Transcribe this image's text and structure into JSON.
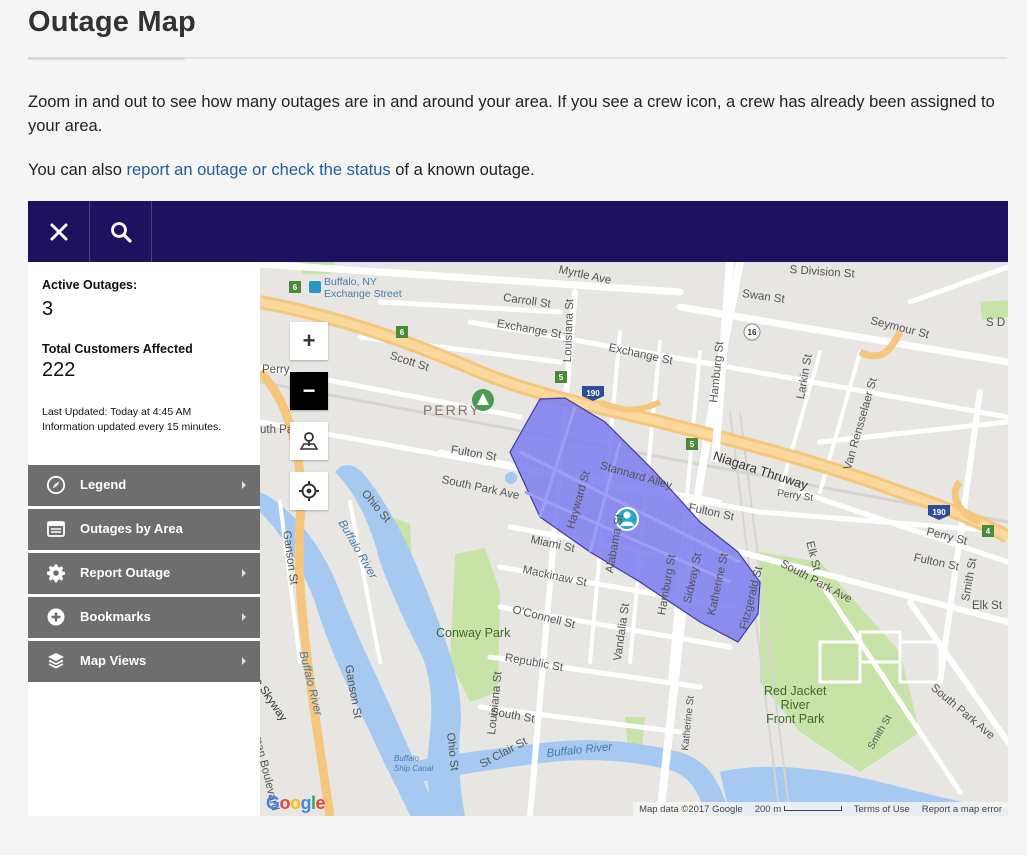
{
  "page": {
    "title": "Outage Map",
    "intro": "Zoom in and out to see how many outages are in and around your area. If you see a crew icon, a crew has already been assigned to your area.",
    "also_prefix": "You can also ",
    "also_link": "report an outage or check the status",
    "also_suffix": " of a known outage."
  },
  "toolbar": {
    "close_icon": "close-icon",
    "search_icon": "search-icon",
    "color": "#1e1160"
  },
  "stats": {
    "active_label": "Active Outages:",
    "active_value": "3",
    "customers_label": "Total Customers Affected",
    "customers_value": "222",
    "updated_line1": "Last Updated: Today at 4:45 AM",
    "updated_line2": "Information updated every 15 minutes."
  },
  "menu": [
    {
      "label": "Legend",
      "icon": "compass-icon",
      "chevron": true
    },
    {
      "label": "Outages by Area",
      "icon": "table-icon",
      "chevron": false
    },
    {
      "label": "Report Outage",
      "icon": "gear-icon",
      "chevron": true
    },
    {
      "label": "Bookmarks",
      "icon": "plus-circle-icon",
      "chevron": true
    },
    {
      "label": "Map Views",
      "icon": "layers-icon",
      "chevron": true
    }
  ],
  "map": {
    "controls": [
      "zoom-in",
      "zoom-out",
      "locate-person",
      "my-location"
    ],
    "zoom_in": "+",
    "zoom_out": "−",
    "outage_color": "#7b7bf0",
    "crew_icon": "crew-icon",
    "labels": {
      "myrtle": "Myrtle Ave",
      "s_division": "S Division St",
      "swan": "Swan St",
      "carroll": "Carroll St",
      "exchange1": "Exchange St",
      "exchange2": "Exchange St",
      "seymour": "Seymour St",
      "s_d": "S D",
      "station": "Buffalo, NY\nExchange Street",
      "scott": "Scott St",
      "perry_w": "Perry",
      "perry": "PERRY",
      "louisiana1": "Louisiana St",
      "hamburg1": "Hamburg St",
      "larkin": "Larkin St",
      "van_rensselaer": "Van Rensselaer St",
      "fulton1": "Fulton St",
      "stannard": "Stannard Alley",
      "hayward": "Hayward St",
      "niagara": "Niagara Thruway",
      "perry_e1": "Perry St",
      "perry_e2": "Perry St",
      "fulton2": "Fulton St",
      "fulton3": "Fulton St",
      "south_park1": "South Park Ave",
      "ohio": "Ohio St",
      "ganson1": "Ganson St",
      "buffalo_river1": "Buffalo River",
      "miami": "Miami St",
      "alabama": "Alabama St",
      "mackinaw": "Mackinaw St",
      "hamburg2": "Hamburg St",
      "sidway": "Sidway St",
      "katherine1": "Katherine St",
      "fitzgerald": "Fitzgerald St",
      "elk1": "Elk St",
      "south_park2": "South Park Ave",
      "smith1": "Smith St",
      "elk2": "Elk St",
      "oconnell": "O'Connell St",
      "vandalia": "Vandalia St",
      "conway": "Conway Park",
      "republic": "Republic St",
      "buffalo_river2": "Buffalo River",
      "ganson2": "Ganson St",
      "louisiana2": "Louisiana St",
      "ohio2": "Ohio St",
      "south_st": "South St",
      "st_clair": "St Clair St",
      "buffalo_river3": "Buffalo River",
      "katherine2": "Katherine St",
      "red_jacket": "Red Jacket\nRiver\nFront Park",
      "smith2": "Smith St",
      "south_park3": "South Park Ave",
      "skyway": "Buffalo Skyway",
      "ship_canal": "Buffalo\nShip Canal",
      "ohio3": "Ohio St",
      "boulevard": "erman Boulevard",
      "sky_w": "lo Skyway",
      "uth_pa": "uth Pa"
    },
    "shields": {
      "i190a": "190",
      "i190b": "190",
      "r5a": "5",
      "r5b": "5",
      "r6a": "6",
      "r6b": "6",
      "r16": "16",
      "r4": "4"
    },
    "attribution": {
      "data": "Map data ©2017 Google",
      "scale": "200 m",
      "terms": "Terms of Use",
      "report": "Report a map error"
    },
    "google": "Google"
  }
}
